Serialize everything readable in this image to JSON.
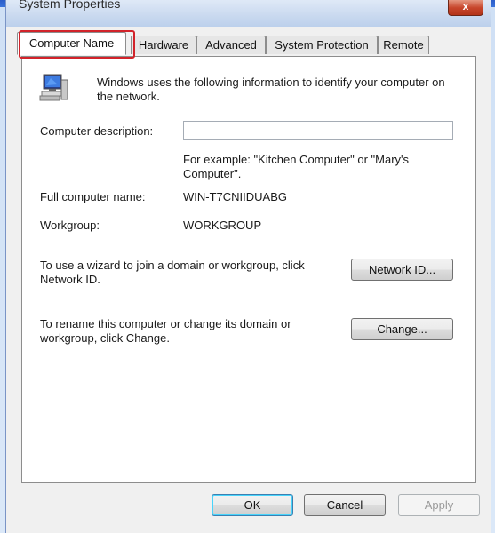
{
  "window": {
    "title": "System Properties",
    "close_glyph": "x"
  },
  "tabs": [
    {
      "label": "Computer Name",
      "active": true
    },
    {
      "label": "Hardware"
    },
    {
      "label": "Advanced"
    },
    {
      "label": "System Protection"
    },
    {
      "label": "Remote"
    }
  ],
  "intro": "Windows uses the following information to identify your computer on the network.",
  "description": {
    "label": "Computer description:",
    "value": "",
    "example": "For example: \"Kitchen Computer\" or \"Mary's Computer\"."
  },
  "full_name": {
    "label": "Full computer name:",
    "value": "WIN-T7CNIIDUABG"
  },
  "workgroup": {
    "label": "Workgroup:",
    "value": "WORKGROUP"
  },
  "network_id": {
    "text": "To use a wizard to join a domain or workgroup, click Network ID.",
    "button_label": "Network ID..."
  },
  "rename": {
    "text": "To rename this computer or change its domain or workgroup, click Change.",
    "button_label": "Change..."
  },
  "footer": {
    "ok": "OK",
    "cancel": "Cancel",
    "apply": "Apply"
  },
  "colors": {
    "highlight": "#d2232a",
    "title_bar_blue": "#1f45a8"
  },
  "icons": {
    "computer": "computer-icon"
  }
}
